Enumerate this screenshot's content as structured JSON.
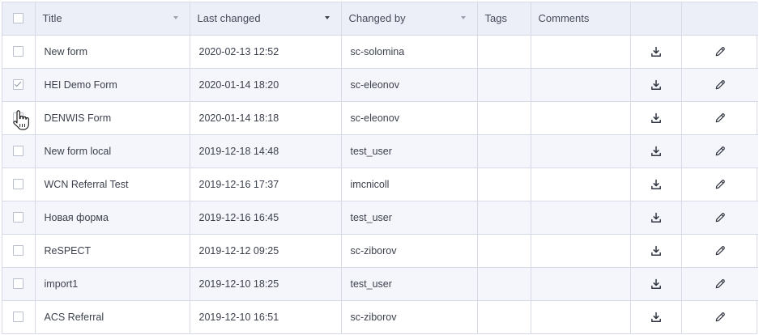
{
  "columns": {
    "select_all": "",
    "title": "Title",
    "last_changed": "Last changed",
    "changed_by": "Changed by",
    "tags": "Tags",
    "comments": "Comments",
    "download": "",
    "edit": ""
  },
  "sort": {
    "column": "last_changed",
    "direction": "desc"
  },
  "rows": [
    {
      "checked": false,
      "title": "New form",
      "last_changed": "2020-02-13 12:52",
      "changed_by": "sc-solomina",
      "tags": "",
      "comments": ""
    },
    {
      "checked": true,
      "title": "HEI Demo Form",
      "last_changed": "2020-01-14 18:20",
      "changed_by": "sc-eleonov",
      "tags": "",
      "comments": ""
    },
    {
      "checked": false,
      "title": "DENWIS Form",
      "last_changed": "2020-01-14 18:18",
      "changed_by": "sc-eleonov",
      "tags": "",
      "comments": ""
    },
    {
      "checked": false,
      "title": "New form local",
      "last_changed": "2019-12-18 14:48",
      "changed_by": "test_user",
      "tags": "",
      "comments": ""
    },
    {
      "checked": false,
      "title": "WCN Referral Test",
      "last_changed": "2019-12-16 17:37",
      "changed_by": "imcnicoll",
      "tags": "",
      "comments": ""
    },
    {
      "checked": false,
      "title": "Новая форма",
      "last_changed": "2019-12-16 16:45",
      "changed_by": "test_user",
      "tags": "",
      "comments": ""
    },
    {
      "checked": false,
      "title": "ReSPECT",
      "last_changed": "2019-12-12 09:25",
      "changed_by": "sc-ziborov",
      "tags": "",
      "comments": ""
    },
    {
      "checked": false,
      "title": "import1",
      "last_changed": "2019-12-10 18:25",
      "changed_by": "test_user",
      "tags": "",
      "comments": ""
    },
    {
      "checked": false,
      "title": "ACS Referral",
      "last_changed": "2019-12-10 16:51",
      "changed_by": "sc-ziborov",
      "tags": "",
      "comments": ""
    }
  ],
  "icons": {
    "download": "download-icon",
    "edit": "pencil-icon",
    "cursor": "hand-pointer-cursor-icon"
  },
  "colors": {
    "header_bg": "#eceff8",
    "row_alt_bg": "#f5f6fb",
    "border": "#d6dae6",
    "text": "#3c414d"
  }
}
